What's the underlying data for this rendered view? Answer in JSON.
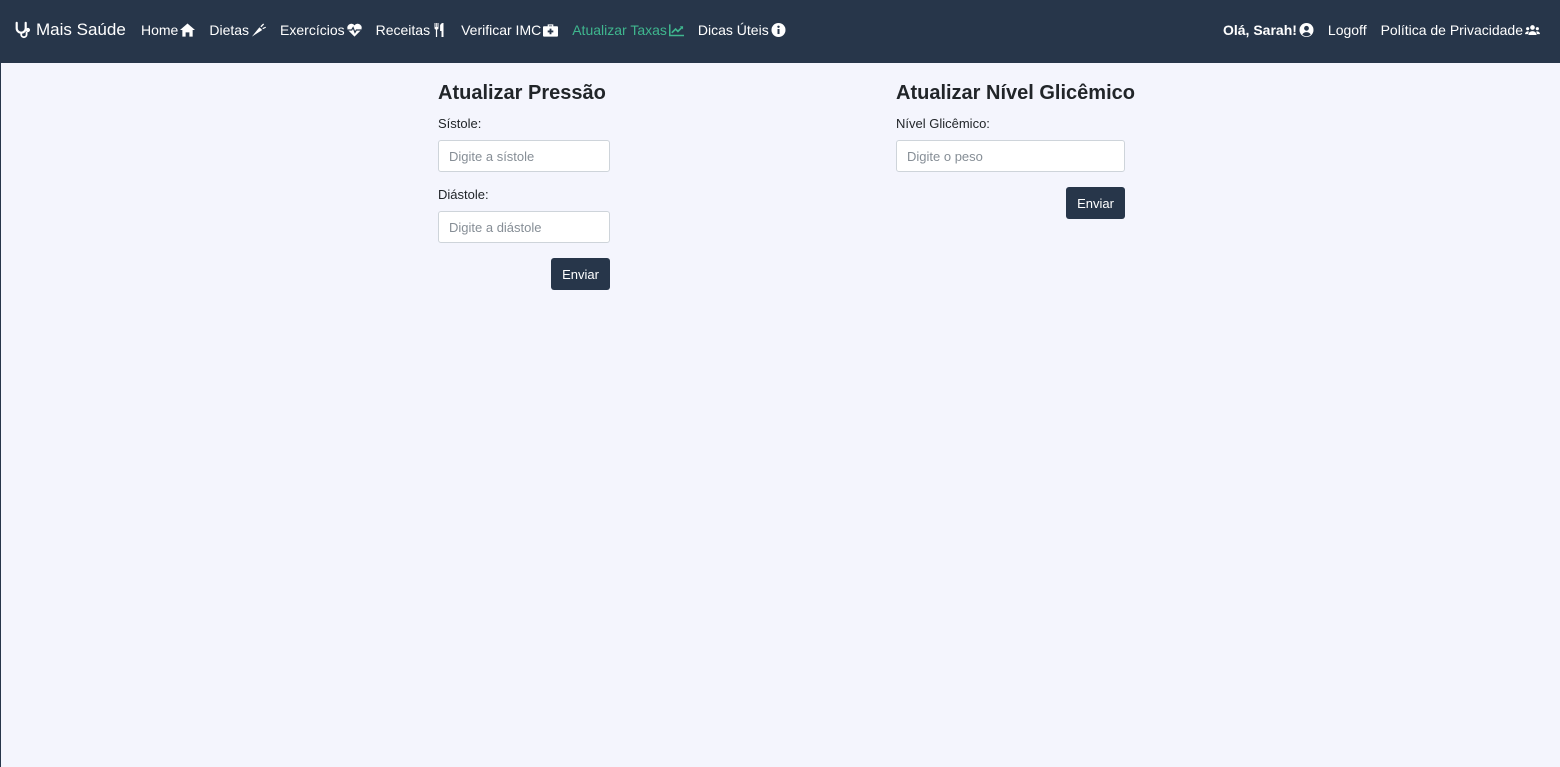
{
  "brand": {
    "name": "Mais Saúde",
    "icon": "stethoscope-icon"
  },
  "nav": {
    "home": "Home",
    "dietas": "Dietas",
    "exercicios": "Exercícios",
    "receitas": "Receitas",
    "verificar_imc": "Verificar IMC",
    "atualizar_taxas": "Atualizar Taxas",
    "dicas_uteis": "Dicas Úteis",
    "active": "Atualizar Taxas"
  },
  "user_nav": {
    "greeting": "Olá, Sarah!",
    "logoff": "Logoff",
    "privacy": "Política de Privacidade"
  },
  "pressure": {
    "title": "Atualizar Pressão",
    "systole_label": "Sístole:",
    "systole_placeholder": "Digite a sístole",
    "diastole_label": "Diástole:",
    "diastole_placeholder": "Digite a diástole",
    "submit": "Enviar"
  },
  "glycemic": {
    "title": "Atualizar Nível Glicêmico",
    "level_label": "Nível Glicêmico:",
    "level_placeholder": "Digite o peso",
    "submit": "Enviar"
  },
  "colors": {
    "navbar": "#27364a",
    "active_link": "#3fb68e",
    "page_background": "#f4f5fd",
    "button": "#27364a"
  }
}
